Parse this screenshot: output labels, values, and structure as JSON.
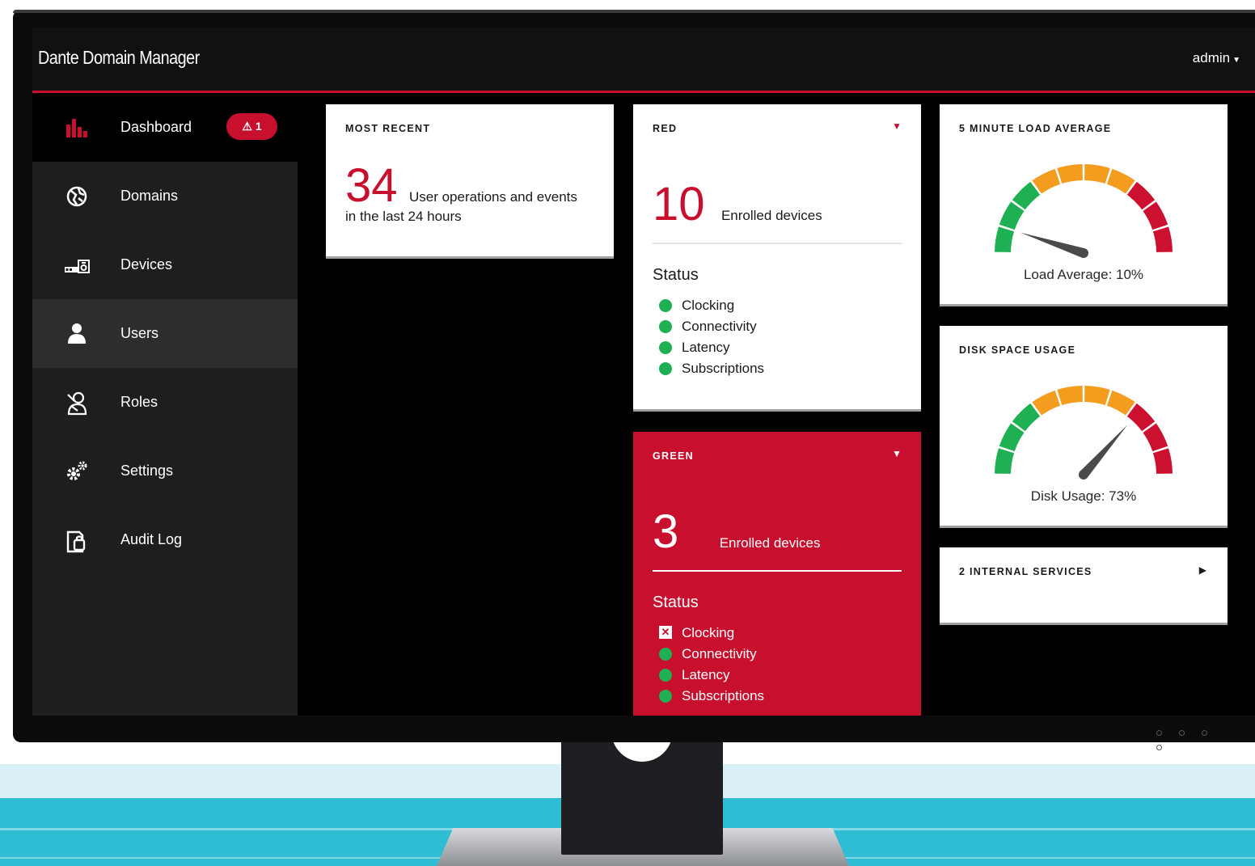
{
  "app": {
    "title": "Dante Domain Manager",
    "user": "admin"
  },
  "sidebar": {
    "items": [
      {
        "label": "Dashboard",
        "icon": "bar-chart-icon",
        "badge": "1",
        "active": true
      },
      {
        "label": "Domains",
        "icon": "globe-icon"
      },
      {
        "label": "Devices",
        "icon": "devices-icon"
      },
      {
        "label": "Users",
        "icon": "user-icon",
        "hover": true
      },
      {
        "label": "Roles",
        "icon": "roles-icon"
      },
      {
        "label": "Settings",
        "icon": "gears-icon"
      },
      {
        "label": "Audit Log",
        "icon": "audit-log-icon"
      }
    ]
  },
  "cards": {
    "recent": {
      "title": "MOST RECENT",
      "value": "34",
      "text1": "User operations and events",
      "text2": "in the last 24 hours"
    },
    "red": {
      "title": "RED",
      "value": "10",
      "label": "Enrolled devices",
      "status_title": "Status",
      "status": [
        {
          "label": "Clocking",
          "state": "ok"
        },
        {
          "label": "Connectivity",
          "state": "ok"
        },
        {
          "label": "Latency",
          "state": "ok"
        },
        {
          "label": "Subscriptions",
          "state": "ok"
        }
      ]
    },
    "green": {
      "title": "GREEN",
      "value": "3",
      "label": "Enrolled devices",
      "status_title": "Status",
      "status": [
        {
          "label": "Clocking",
          "state": "error"
        },
        {
          "label": "Connectivity",
          "state": "ok"
        },
        {
          "label": "Latency",
          "state": "ok"
        },
        {
          "label": "Subscriptions",
          "state": "ok"
        }
      ]
    },
    "load": {
      "title": "5 MINUTE LOAD AVERAGE",
      "label": "Load Average: 10%",
      "value": 0.1
    },
    "disk": {
      "title": "DISK SPACE USAGE",
      "label": "Disk Usage: 73%",
      "value": 0.73
    },
    "services": {
      "title": "2 INTERNAL SERVICES"
    }
  },
  "colors": {
    "brand_red": "#c8102e",
    "ok_green": "#1eb053",
    "gauge_green": "#1eb053",
    "gauge_orange": "#f39c1e",
    "gauge_red": "#cc1030"
  }
}
